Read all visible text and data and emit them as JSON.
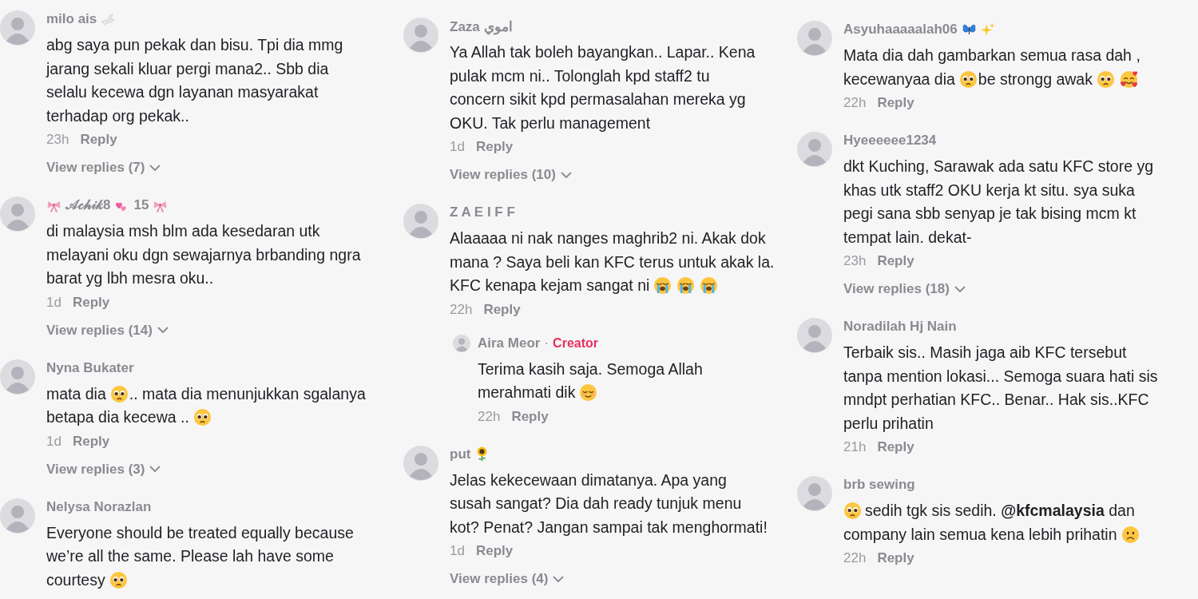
{
  "columns": [
    {
      "comments": [
        {
          "author": [
            "milo ais",
            {
              "kind": "dove"
            }
          ],
          "text": [
            "abg saya pun pekak dan bisu. Tpi dia mmg\njarang sekali kluar pergi mana2.. Sbb dia\nselalu kecewa dgn layanan masyarakat\nterhadap org pekak.."
          ],
          "time": "23h",
          "reply_label": "Reply",
          "view_replies": "View replies (7)"
        },
        {
          "author": [
            {
              "kind": "ribbon"
            },
            "𝒜𝒸𝒽𝒾𝓀8",
            {
              "kind": "twohearts"
            },
            "15",
            {
              "kind": "ribbon"
            }
          ],
          "text": [
            "di malaysia msh blm ada kesedaran utk\nmelayani oku dgn sewajarnya brbanding ngra\nbarat yg lbh mesra oku.."
          ],
          "time": "1d",
          "reply_label": "Reply",
          "view_replies": "View replies (14)"
        },
        {
          "author": [
            "Nyna Bukater"
          ],
          "text": [
            "mata dia",
            {
              "kind": "pleading"
            },
            ".. mata dia menunjukkan sgalanya\nbetapa dia kecewa ..",
            {
              "kind": "pleading"
            }
          ],
          "time": "1d",
          "reply_label": "Reply",
          "view_replies": "View replies (3)"
        },
        {
          "author": [
            "Nelysa Norazlan"
          ],
          "text": [
            "Everyone should be treated equally because\nwe’re all the same. Please lah have some\ncourtesy",
            {
              "kind": "pleading"
            }
          ]
        }
      ]
    },
    {
      "comments": [
        {
          "author": [
            "Zaza اموي"
          ],
          "text": [
            "Ya Allah tak boleh bayangkan.. Lapar.. Kena\npulak mcm ni.. Tolonglah kpd staff2 tu\nconcern sikit kpd permasalahan mereka yg\nOKU. Tak perlu management"
          ],
          "time": "1d",
          "reply_label": "Reply",
          "view_replies": "View replies (10)"
        },
        {
          "author": [
            "Z A E I F F"
          ],
          "text": [
            "Alaaaaa ni nak nanges maghrib2 ni. Akak dok\nmana ? Saya beli kan KFC terus untuk akak la.\nKFC kenapa kejam sangat ni",
            {
              "kind": "crying"
            },
            {
              "kind": "crying"
            },
            {
              "kind": "crying"
            }
          ],
          "time": "22h",
          "reply_label": "Reply",
          "replies": [
            {
              "author": [
                "Aira Meor"
              ],
              "separator": "·",
              "badge": "Creator",
              "text": [
                "Terima kasih saja. Semoga Allah\nmerahmati dik",
                {
                  "kind": "relieved"
                }
              ],
              "time": "22h",
              "reply_label": "Reply"
            }
          ]
        },
        {
          "author": [
            "put",
            {
              "kind": "sunflower"
            }
          ],
          "text": [
            "Jelas kekecewaan dimatanya. Apa yang\nsusah sangat? Dia dah ready tunjuk menu\nkot? Penat? Jangan sampai tak menghormati!"
          ],
          "time": "1d",
          "reply_label": "Reply",
          "view_replies": "View replies (4)"
        }
      ]
    },
    {
      "comments": [
        {
          "author": [
            "Asyuhaaaaalah06",
            {
              "kind": "butterfly"
            },
            {
              "kind": "sparkles"
            }
          ],
          "text": [
            "Mata dia dah gambarkan semua rasa dah ,\nkecewanyaa dia",
            {
              "kind": "pleading"
            },
            "be strongg awak",
            {
              "kind": "pleading"
            },
            {
              "kind": "adoring"
            }
          ],
          "time": "22h",
          "reply_label": "Reply"
        },
        {
          "author": [
            "Hyeeeeee1234"
          ],
          "text": [
            "dkt Kuching, Sarawak ada satu KFC store yg\nkhas utk staff2 OKU kerja kt situ. sya suka\npegi sana sbb senyap je tak bising mcm kt\ntempat lain. dekat-"
          ],
          "time": "23h",
          "reply_label": "Reply",
          "view_replies": "View replies (18)"
        },
        {
          "author": [
            "Noradilah Hj Nain"
          ],
          "text": [
            "Terbaik sis.. Masih jaga aib KFC tersebut\ntanpa mention lokasi... Semoga suara hati sis\nmndpt perhatian KFC.. Benar.. Hak sis..KFC\nperlu prihatin"
          ],
          "time": "21h",
          "reply_label": "Reply"
        },
        {
          "author": [
            "brb sewing"
          ],
          "text": [
            {
              "kind": "pleading"
            },
            "sedih tgk sis sedih. **@kfcmalaysia** dan\ncompany lain semua kena lebih prihatin",
            {
              "kind": "frowning"
            }
          ],
          "time": "22h",
          "reply_label": "Reply"
        }
      ]
    }
  ]
}
